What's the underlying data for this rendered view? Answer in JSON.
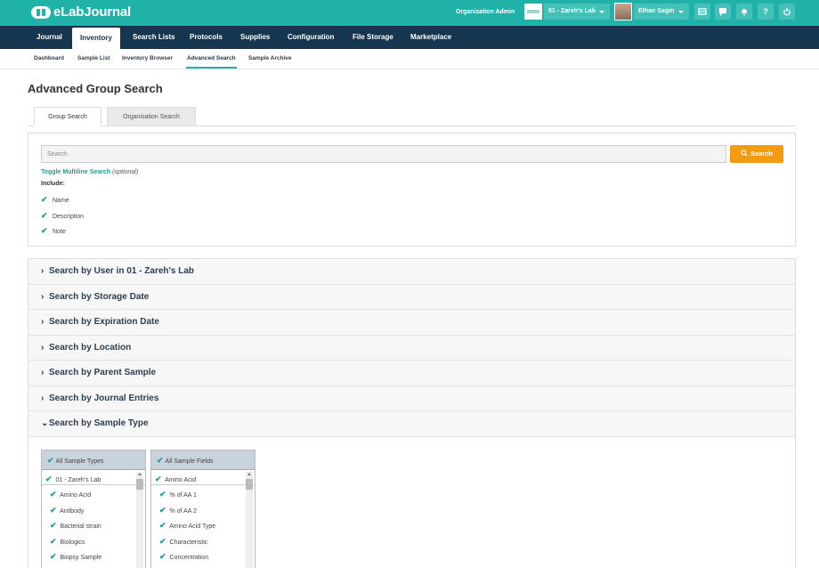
{
  "topbar": {
    "app_name": "eLabJournal",
    "org_admin": "Organization Admin",
    "lab": "01 - Zareh's Lab",
    "user": "Ethan Sagin",
    "icons": [
      "inbox-icon",
      "chat-icon",
      "bell-icon",
      "help-icon",
      "power-icon"
    ],
    "help_glyph": "?"
  },
  "mainnav": {
    "items": [
      "Journal",
      "Inventory",
      "Search Lists",
      "Protocols",
      "Supplies",
      "Configuration",
      "File Storage",
      "Marketplace"
    ],
    "active": "Inventory"
  },
  "subnav": {
    "items": [
      "Dashboard",
      "Sample List",
      "Inventory Browser",
      "Advanced Search",
      "Sample Archive"
    ],
    "active": "Advanced Search"
  },
  "page": {
    "title": "Advanced Group Search"
  },
  "tabs": [
    "Group Search",
    "Organisation Search"
  ],
  "search": {
    "placeholder": "Search",
    "button_label": "Search",
    "toggle_label": "Toggle Multiline Search",
    "toggle_optional": "(optional)",
    "include_label": "Include:",
    "includes": [
      "Name",
      "Description",
      "Note"
    ]
  },
  "accordion": {
    "sections": [
      "Search by User in 01 - Zareh's Lab",
      "Search by Storage Date",
      "Search by Expiration Date",
      "Search by Location",
      "Search by Parent Sample",
      "Search by Journal Entries",
      "Search by Sample Type"
    ],
    "open_section": "Search by Sample Type"
  },
  "sample_types": {
    "header": "All Sample Types",
    "group": "01 - Zareh's Lab",
    "items": [
      "Amino Acid",
      "Antibody",
      "Bacterial strain",
      "Biologics",
      "Biopsy Sample"
    ]
  },
  "sample_fields": {
    "header": "All Sample Fields",
    "group": "Amino Acid",
    "items": [
      "% of AA 1",
      "% of AA 2",
      "Amino Acid Type",
      "Characteristic",
      "Concentration"
    ]
  },
  "colors": {
    "topbar": "#20b1a8",
    "mainnav": "#16354f",
    "accent": "#1f9a92",
    "search_button": "#f39c12"
  }
}
